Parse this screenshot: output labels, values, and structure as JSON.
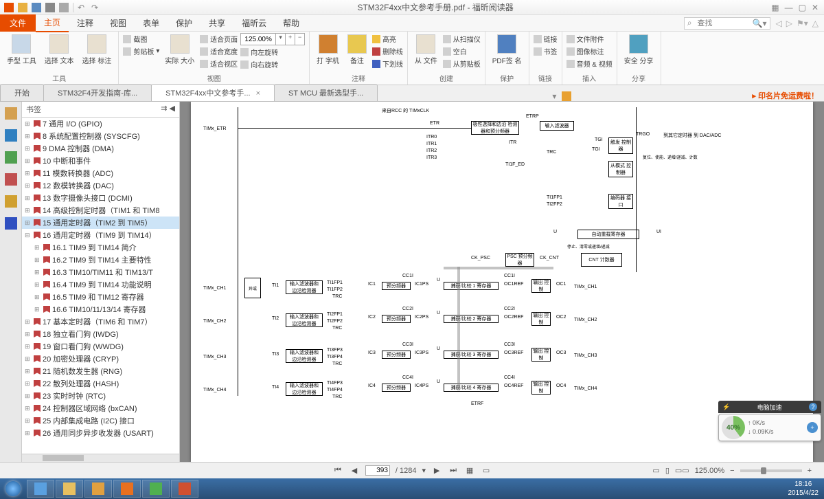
{
  "window": {
    "title": "STM32F4xx中文参考手册.pdf - 福昕阅读器"
  },
  "menu": {
    "file": "文件",
    "items": [
      "主页",
      "注释",
      "视图",
      "表单",
      "保护",
      "共享",
      "福昕云",
      "帮助"
    ],
    "search_placeholder": "查找"
  },
  "ribbon": {
    "tools": {
      "hand": "手型\n工具",
      "select_text": "选择\n文本",
      "select_anno": "选择\n标注",
      "group": "工具"
    },
    "view": {
      "screenshot": "截图",
      "clipboard": "剪贴板",
      "realsize": "实际\n大小",
      "fitpage": "适合页面",
      "fitwidth": "适合宽度",
      "fitvisible": "适合视区",
      "rotleft": "向左旋转",
      "rotright": "向右旋转",
      "zoom": "125.00%",
      "group": "视图"
    },
    "comment": {
      "typewriter": "打\n字机",
      "note": "备注",
      "highlight": "高亮",
      "strikeout": "删除线",
      "underline": "下划线",
      "group": "注释"
    },
    "create": {
      "fromfile": "从\n文件",
      "fromscanner": "从扫描仪",
      "blank": "空白",
      "fromclipboard": "从剪贴板",
      "group": "创建"
    },
    "protect": {
      "pdfsign": "PDF签\n名",
      "group": "保护"
    },
    "links": {
      "link": "链接",
      "bookmark": "书签",
      "fileattach": "文件附件",
      "imageanno": "图像标注",
      "audiovideo": "音频 & 视频",
      "group1": "链接",
      "group2": "插入"
    },
    "share": {
      "safeshare": "安全\n分享",
      "group": "分享"
    }
  },
  "tabs": {
    "items": [
      {
        "label": "开始"
      },
      {
        "label": "STM32F4开发指南-库..."
      },
      {
        "label": "STM32F4xx中文参考手...",
        "active": true
      },
      {
        "label": "ST MCU 最新选型手..."
      }
    ],
    "promo": "印名片免运费啦！"
  },
  "bookmarks": {
    "title": "书签",
    "items": [
      {
        "n": "7",
        "t": "通用 I/O (GPIO)",
        "lvl": 1
      },
      {
        "n": "8",
        "t": "系统配置控制器 (SYSCFG)",
        "lvl": 1
      },
      {
        "n": "9",
        "t": "DMA 控制器 (DMA)",
        "lvl": 1
      },
      {
        "n": "10",
        "t": "中断和事件",
        "lvl": 1
      },
      {
        "n": "11",
        "t": "模数转换器 (ADC)",
        "lvl": 1
      },
      {
        "n": "12",
        "t": "数模转换器 (DAC)",
        "lvl": 1
      },
      {
        "n": "13",
        "t": "数字摄像头接口 (DCMI)",
        "lvl": 1
      },
      {
        "n": "14",
        "t": "高级控制定时器（TIM1 和 TIM8",
        "lvl": 1
      },
      {
        "n": "15",
        "t": "通用定时器（TIM2 到 TIM5）",
        "lvl": 1,
        "sel": true
      },
      {
        "n": "16",
        "t": "通用定时器（TIM9 到 TIM14）",
        "lvl": 1,
        "exp": true
      },
      {
        "n": "16.1",
        "t": "TIM9 到 TIM14 简介",
        "lvl": 2
      },
      {
        "n": "16.2",
        "t": "TIM9 到 TIM14 主要特性",
        "lvl": 2
      },
      {
        "n": "16.3",
        "t": "TIM10/TIM11 和 TIM13/T",
        "lvl": 2
      },
      {
        "n": "16.4",
        "t": "TIM9 到 TIM14 功能说明",
        "lvl": 2
      },
      {
        "n": "16.5",
        "t": "TIM9 和 TIM12 寄存器",
        "lvl": 2
      },
      {
        "n": "16.6",
        "t": "TIM10/11/13/14 寄存器",
        "lvl": 2
      },
      {
        "n": "17",
        "t": "基本定时器（TIM6 和 TIM7）",
        "lvl": 1
      },
      {
        "n": "18",
        "t": "独立看门狗 (IWDG)",
        "lvl": 1
      },
      {
        "n": "19",
        "t": "窗口看门狗 (WWDG)",
        "lvl": 1
      },
      {
        "n": "20",
        "t": "加密处理器 (CRYP)",
        "lvl": 1
      },
      {
        "n": "21",
        "t": "随机数发生器 (RNG)",
        "lvl": 1
      },
      {
        "n": "22",
        "t": "散列处理器 (HASH)",
        "lvl": 1
      },
      {
        "n": "23",
        "t": "实时时钟 (RTC)",
        "lvl": 1
      },
      {
        "n": "24",
        "t": "控制器区域网络 (bxCAN)",
        "lvl": 1
      },
      {
        "n": "25",
        "t": "内部集成电路 (I2C) 接口",
        "lvl": 1
      },
      {
        "n": "26",
        "t": "通用同步异步收发器 (USART)",
        "lvl": 1
      }
    ]
  },
  "footer": {
    "page_current": "393",
    "page_total": "1284",
    "zoom": "125.00%"
  },
  "diagram": {
    "source_note": "来自RCC 的 TIMxCLK",
    "etrp": "ETRP",
    "etr": "ETR",
    "timx_etr": "TIMx_ETR",
    "polarity": "极性选择和边沿\n检测器和预分频器",
    "input_filter": "输入滤波器",
    "itr0": "ITR0",
    "itr1": "ITR1",
    "itr2": "ITR2",
    "itr3": "ITR3",
    "itr": "ITR",
    "trc": "TRC",
    "ti1f_ed": "TI1F_ED",
    "tgi": "TGI",
    "trig_ctrl": "触发\n控制器",
    "trgo": "TRGO",
    "to_other": "到其它定时器\n到 DAC/ADC",
    "slave_ctrl": "从模式\n控制器",
    "reset_note": "复位、使能、递增/递减、计数",
    "ti1fp1": "TI1FP1",
    "ti2fp2": "TI2FP2",
    "encoder": "编码器\n接口",
    "u": "U",
    "ui": "UI",
    "autoreload": "自动重载寄存器",
    "stop_note": "停止、清零或递增/递减",
    "ck_psc": "CK_PSC",
    "psc": "PSC\n预分频器",
    "ck_cnt": "CK_CNT",
    "cnt": "CNT\n计数器",
    "timx_ch1": "TIMx_CH1",
    "timx_ch2": "TIMx_CH2",
    "timx_ch3": "TIMx_CH3",
    "timx_ch4": "TIMx_CH4",
    "xor": "异或",
    "ti1": "TI1",
    "ti2": "TI2",
    "ti3": "TI3",
    "ti4": "TI4",
    "edge": "输入滤波器和\n边沿检测器",
    "ic1": "IC1",
    "ic2": "IC2",
    "ic3": "IC3",
    "ic4": "IC4",
    "ic1ps": "IC1PS",
    "ic2ps": "IC2PS",
    "ic3ps": "IC3PS",
    "ic4ps": "IC4PS",
    "cc1i": "CC1I",
    "cc2i": "CC2I",
    "cc3i": "CC3I",
    "cc4i": "CC4I",
    "prescaler": "预分频器",
    "ccr1": "捕获/比较 1 寄存器",
    "ccr2": "捕获/比较 2 寄存器",
    "ccr3": "捕获/比较 3 寄存器",
    "ccr4": "捕获/比较 4 寄存器",
    "oc1ref": "OC1REF",
    "oc2ref": "OC2REF",
    "oc3ref": "OC3REF",
    "oc4ref": "OC4REF",
    "output_ctrl": "输出\n控制",
    "oc1": "OC1",
    "oc2": "OC2",
    "oc3": "OC3",
    "oc4": "OC4",
    "etrf": "ETRF",
    "ti1fp2_l": "TI1FP2",
    "ti2fp1_l": "TI2FP1",
    "ti3fp3": "TI3FP3",
    "ti3fp4": "TI3FP4",
    "ti4fp3": "TI4FP3",
    "ti4fp4": "TI4FP4"
  },
  "net": {
    "percent": "40%",
    "up": "0K/s",
    "down": "0.09K/s",
    "accel": "电脑加速"
  },
  "clock": {
    "time": "18:16",
    "date": "2015/4/22"
  }
}
